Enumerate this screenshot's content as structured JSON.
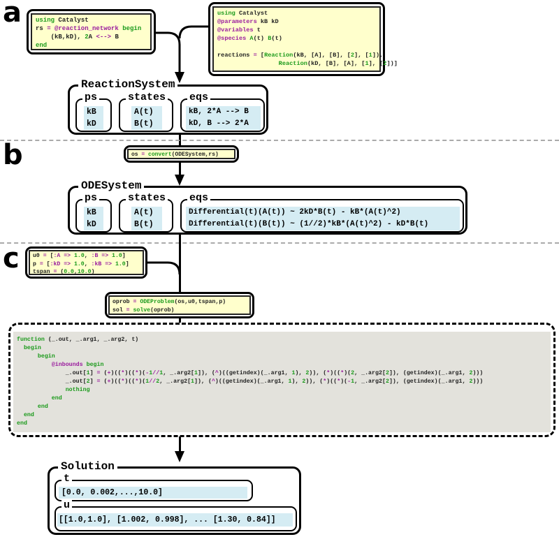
{
  "panel_labels": {
    "a": "a",
    "b": "b",
    "c": "c"
  },
  "colors": {
    "keyword": "#1b9a1b",
    "operator": "#9a1c9e",
    "code_bg": "#ffffcc",
    "cell_bg": "#d5ecf3",
    "function_bg": "#e3e2dc"
  },
  "codes": {
    "dsl": [
      [
        [
          "k",
          "using"
        ],
        [
          "t",
          " Catalyst"
        ]
      ],
      [
        [
          "t",
          "rs "
        ],
        [
          "m",
          "= @reaction_network"
        ],
        [
          "k",
          " begin"
        ]
      ],
      [
        [
          "t",
          "    (kB,kD), "
        ],
        [
          "k",
          "2"
        ],
        [
          "t",
          "A "
        ],
        [
          "m",
          "<-->"
        ],
        [
          "t",
          " B"
        ]
      ],
      [
        [
          "k",
          "end"
        ]
      ]
    ],
    "api": [
      [
        [
          "k",
          "using"
        ],
        [
          "t",
          " Catalyst"
        ]
      ],
      [
        [
          "m",
          "@parameters"
        ],
        [
          "t",
          " kB kD"
        ]
      ],
      [
        [
          "m",
          "@variables"
        ],
        [
          "t",
          " t"
        ]
      ],
      [
        [
          "m",
          "@species"
        ],
        [
          "k",
          " A"
        ],
        [
          "t",
          "(t) "
        ],
        [
          "k",
          "B"
        ],
        [
          "t",
          "(t)"
        ]
      ],
      [
        [
          "t",
          " "
        ]
      ],
      [
        [
          "t",
          "reactions "
        ],
        [
          "m",
          "="
        ],
        [
          "t",
          " ["
        ],
        [
          "k",
          "Reaction"
        ],
        [
          "t",
          "(kB, [A], [B], ["
        ],
        [
          "k",
          "2"
        ],
        [
          "t",
          "], ["
        ],
        [
          "k",
          "1"
        ],
        [
          "t",
          "]),"
        ]
      ],
      [
        [
          "t",
          "                 "
        ],
        [
          "k",
          "Reaction"
        ],
        [
          "t",
          "(kD, [B], [A], ["
        ],
        [
          "k",
          "1"
        ],
        [
          "t",
          "], ["
        ],
        [
          "k",
          "2"
        ],
        [
          "t",
          "])]"
        ]
      ]
    ],
    "convert": [
      [
        [
          "t",
          "os "
        ],
        [
          "m",
          "="
        ],
        [
          "k",
          " convert"
        ],
        [
          "t",
          "(ODESystem,rs)"
        ]
      ]
    ],
    "params": [
      [
        [
          "t",
          "u0 "
        ],
        [
          "m",
          "="
        ],
        [
          "t",
          " ["
        ],
        [
          "m",
          ":A =>"
        ],
        [
          "k",
          " 1.0"
        ],
        [
          "t",
          ", "
        ],
        [
          "m",
          ":B =>"
        ],
        [
          "k",
          " 1.0"
        ],
        [
          "t",
          "]"
        ]
      ],
      [
        [
          "t",
          "p "
        ],
        [
          "m",
          "="
        ],
        [
          "t",
          " ["
        ],
        [
          "m",
          ":kD =>"
        ],
        [
          "k",
          " 1.0"
        ],
        [
          "t",
          ", "
        ],
        [
          "m",
          ":kB =>"
        ],
        [
          "k",
          " 1.0"
        ],
        [
          "t",
          "]"
        ]
      ],
      [
        [
          "t",
          "tspan "
        ],
        [
          "m",
          "="
        ],
        [
          "t",
          " ("
        ],
        [
          "k",
          "0.0"
        ],
        [
          "t",
          ","
        ],
        [
          "k",
          "10.0"
        ],
        [
          "t",
          ")"
        ]
      ]
    ],
    "solve": [
      [
        [
          "t",
          "oprob "
        ],
        [
          "m",
          "="
        ],
        [
          "k",
          " ODEProblem"
        ],
        [
          "t",
          "(os,u0,tspan,p)"
        ]
      ],
      [
        [
          "t",
          "sol "
        ],
        [
          "m",
          "="
        ],
        [
          "k",
          " solve"
        ],
        [
          "t",
          "(oprob)"
        ]
      ]
    ],
    "function": [
      [
        [
          "k",
          "function"
        ],
        [
          "t",
          " (_.out, _.arg1, _.arg2, t)"
        ]
      ],
      [
        [
          "k",
          "  begin"
        ]
      ],
      [
        [
          "k",
          "      begin"
        ]
      ],
      [
        [
          "m",
          "          @inbounds"
        ],
        [
          "k",
          " begin"
        ]
      ],
      [
        [
          "t",
          "              _.out["
        ],
        [
          "k",
          "1"
        ],
        [
          "t",
          "] "
        ],
        [
          "m",
          "="
        ],
        [
          "t",
          " ("
        ],
        [
          "m",
          "+"
        ],
        [
          "t",
          ")(("
        ],
        [
          "m",
          "*"
        ],
        [
          "t",
          ")(("
        ],
        [
          "m",
          "*"
        ],
        [
          "t",
          ")("
        ],
        [
          "m",
          "-"
        ],
        [
          "k",
          "1"
        ],
        [
          "m",
          "//"
        ],
        [
          "k",
          "1"
        ],
        [
          "t",
          ", _.arg2["
        ],
        [
          "k",
          "1"
        ],
        [
          "t",
          "]), ("
        ],
        [
          "m",
          "^"
        ],
        [
          "t",
          ")((getindex)(_.arg1, "
        ],
        [
          "k",
          "1"
        ],
        [
          "t",
          "), "
        ],
        [
          "k",
          "2"
        ],
        [
          "t",
          ")), ("
        ],
        [
          "m",
          "*"
        ],
        [
          "t",
          ")(("
        ],
        [
          "m",
          "*"
        ],
        [
          "t",
          ")("
        ],
        [
          "k",
          "2"
        ],
        [
          "t",
          ", _.arg2["
        ],
        [
          "k",
          "2"
        ],
        [
          "t",
          "]), (getindex)(_.arg1, "
        ],
        [
          "k",
          "2"
        ],
        [
          "t",
          ")))"
        ]
      ],
      [
        [
          "t",
          "              _.out["
        ],
        [
          "k",
          "2"
        ],
        [
          "t",
          "] "
        ],
        [
          "m",
          "="
        ],
        [
          "t",
          " ("
        ],
        [
          "m",
          "+"
        ],
        [
          "t",
          ")(("
        ],
        [
          "m",
          "*"
        ],
        [
          "t",
          ")(("
        ],
        [
          "m",
          "*"
        ],
        [
          "t",
          ")("
        ],
        [
          "k",
          "1"
        ],
        [
          "m",
          "//"
        ],
        [
          "k",
          "2"
        ],
        [
          "t",
          ", _.arg2["
        ],
        [
          "k",
          "1"
        ],
        [
          "t",
          "]), ("
        ],
        [
          "m",
          "^"
        ],
        [
          "t",
          ")((getindex)(_.arg1, "
        ],
        [
          "k",
          "1"
        ],
        [
          "t",
          "), "
        ],
        [
          "k",
          "2"
        ],
        [
          "t",
          ")), ("
        ],
        [
          "m",
          "*"
        ],
        [
          "t",
          ")(("
        ],
        [
          "m",
          "*"
        ],
        [
          "t",
          ")("
        ],
        [
          "m",
          "-"
        ],
        [
          "k",
          "1"
        ],
        [
          "t",
          ", _.arg2["
        ],
        [
          "k",
          "2"
        ],
        [
          "t",
          "]), (getindex)(_.arg1, "
        ],
        [
          "k",
          "2"
        ],
        [
          "t",
          ")))"
        ]
      ],
      [
        [
          "k",
          "              nothing"
        ]
      ],
      [
        [
          "k",
          "          end"
        ]
      ],
      [
        [
          "k",
          "      end"
        ]
      ],
      [
        [
          "k",
          "  end"
        ]
      ],
      [
        [
          "k",
          "end"
        ]
      ]
    ]
  },
  "reaction_system": {
    "title": "ReactionSystem",
    "ps": {
      "label": "ps",
      "values": "kB\nkD"
    },
    "states": {
      "label": "states",
      "values": "A(t)\nB(t)"
    },
    "eqs": {
      "label": "eqs",
      "values": "kB, 2*A --> B\nkD, B --> 2*A"
    }
  },
  "ode_system": {
    "title": "ODESystem",
    "ps": {
      "label": "ps",
      "values": "kB\nkD"
    },
    "states": {
      "label": "states",
      "values": "A(t)\nB(t)"
    },
    "eqs": {
      "label": "eqs",
      "values": "Differential(t)(A(t)) ~ 2kD*B(t) - kB*(A(t)^2)\nDifferential(t)(B(t)) ~ (1//2)*kB*(A(t)^2) - kD*B(t)"
    }
  },
  "solution": {
    "title": "Solution",
    "t": {
      "label": "t",
      "values": "[0.0, 0.002,...,10.0]"
    },
    "u": {
      "label": "u",
      "values": "[[1.0,1.0], [1.002, 0.998], ... [1.30, 0.84]]"
    }
  }
}
